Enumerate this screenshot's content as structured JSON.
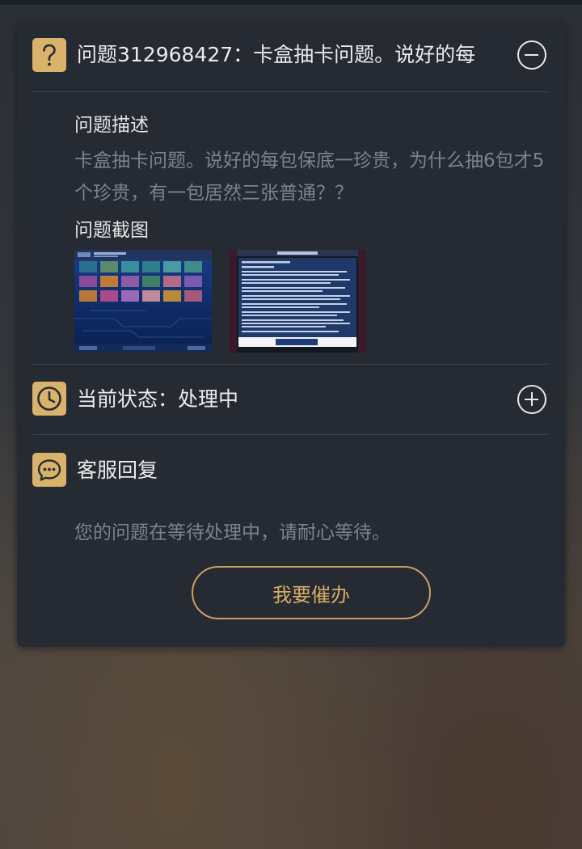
{
  "question": {
    "title": "问题312968427：卡盒抽卡问题。说好的每",
    "description_label": "问题描述",
    "description": "卡盒抽卡问题。说好的每包保底一珍贵，为什么抽6包才5个珍贵，有一包居然三张普通？？",
    "screenshots_label": "问题截图",
    "icon": "question-mark-icon",
    "toggle_icon": "collapse-minus-icon"
  },
  "status": {
    "label": "当前状态：处理中",
    "icon": "clock-icon",
    "toggle_icon": "expand-plus-icon"
  },
  "reply": {
    "label": "客服回复",
    "icon": "chat-bubble-icon",
    "text": "您的问题在等待处理中，请耐心等待。",
    "urge_button": "我要催办"
  },
  "colors": {
    "accent": "#d9b26b",
    "panel": "#262a32",
    "text_primary": "#ececec",
    "text_secondary": "#7d828b"
  }
}
